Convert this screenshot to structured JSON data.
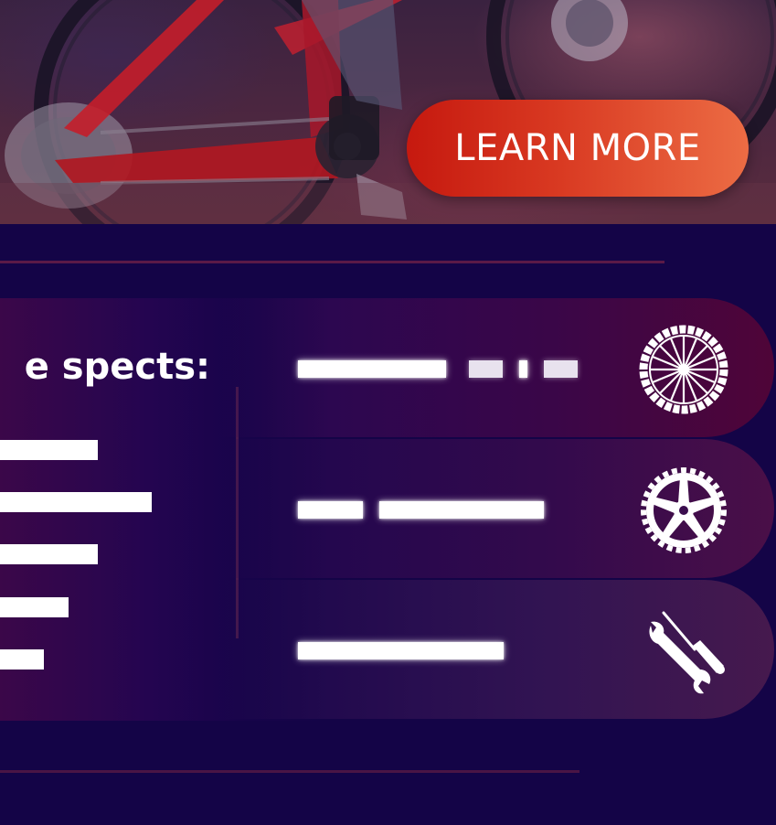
{
  "hero": {
    "cta_label": "LEARN MORE"
  },
  "specs": {
    "title": "e spects:"
  },
  "features": [
    {
      "icon": "bicycle-wheel-icon"
    },
    {
      "icon": "chainring-gear-icon"
    },
    {
      "icon": "screwdriver-wrench-icon"
    }
  ],
  "colors": {
    "background": "#140447",
    "button_gradient_start": "#c6190f",
    "button_gradient_end": "#ec6c44",
    "divider": "#5a1a47"
  }
}
